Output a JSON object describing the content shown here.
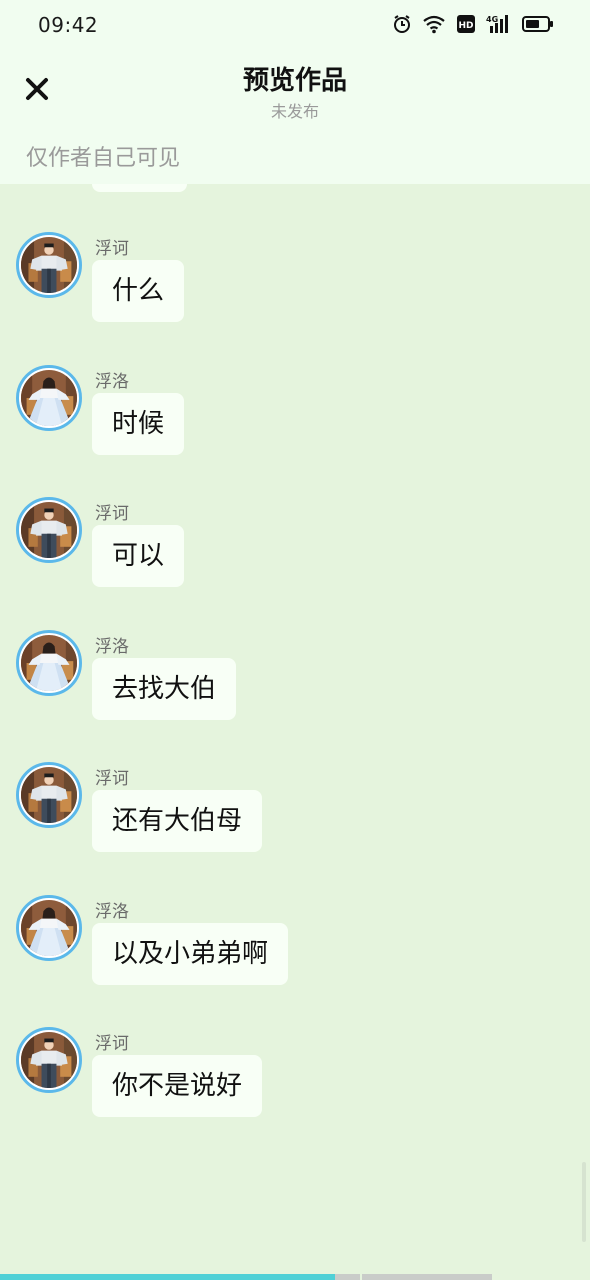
{
  "status_bar": {
    "time": "09:42",
    "icons": [
      "alarm-icon",
      "wifi-icon",
      "hd-icon",
      "4g-signal-icon",
      "battery-icon"
    ],
    "hd_label": "HD",
    "network_label": "4G"
  },
  "header": {
    "close_icon": "close-icon",
    "title": "预览作品",
    "subtitle": "未发布",
    "visibility_note": "仅作者自己可见"
  },
  "messages": [
    {
      "sender": "浮诃",
      "avatar": "boy",
      "text": "什么"
    },
    {
      "sender": "浮洛",
      "avatar": "girl",
      "text": "时候"
    },
    {
      "sender": "浮诃",
      "avatar": "boy",
      "text": "可以"
    },
    {
      "sender": "浮洛",
      "avatar": "girl",
      "text": "去找大伯"
    },
    {
      "sender": "浮诃",
      "avatar": "boy",
      "text": "还有大伯母"
    },
    {
      "sender": "浮洛",
      "avatar": "girl",
      "text": "以及小弟弟啊"
    },
    {
      "sender": "浮诃",
      "avatar": "boy",
      "text": "你不是说好"
    }
  ],
  "progress": {
    "played_fraction": 0.57
  },
  "colors": {
    "background": "#e5f4dd",
    "header_bg": "#f1fdf0",
    "bubble_bg": "#f8fff6",
    "avatar_ring": "#5bb8ea",
    "progress_accent": "#4fd0d6"
  }
}
